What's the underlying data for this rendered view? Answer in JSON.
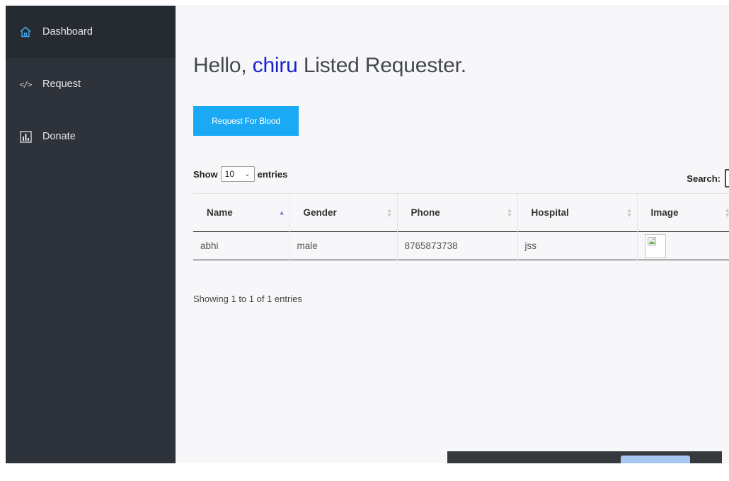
{
  "sidebar": {
    "items": [
      {
        "label": "Dashboard",
        "icon": "home-icon"
      },
      {
        "label": "Request",
        "icon": "code-icon",
        "glyph": "</>"
      },
      {
        "label": "Donate",
        "icon": "bar-chart-icon"
      }
    ]
  },
  "main": {
    "greeting_prefix": "Hello,",
    "user_name": "chiru",
    "greeting_suffix": "Listed Requester.",
    "request_button": "Request For Blood",
    "length": {
      "show": "Show",
      "value": "10",
      "entries": "entries"
    },
    "search": {
      "label": "Search:"
    },
    "table": {
      "columns": [
        "Name",
        "Gender",
        "Phone",
        "Hospital",
        "Image"
      ],
      "rows": [
        {
          "name": "abhi",
          "gender": "male",
          "phone": "8765873738",
          "hospital": "jss"
        }
      ]
    },
    "info": "Showing 1 to 1 of 1 entries"
  },
  "colors": {
    "sidebar": "#2d323b",
    "sidebar_active": "#262a31",
    "accent_button": "#19a9f5",
    "user_name": "#1a23c9"
  }
}
